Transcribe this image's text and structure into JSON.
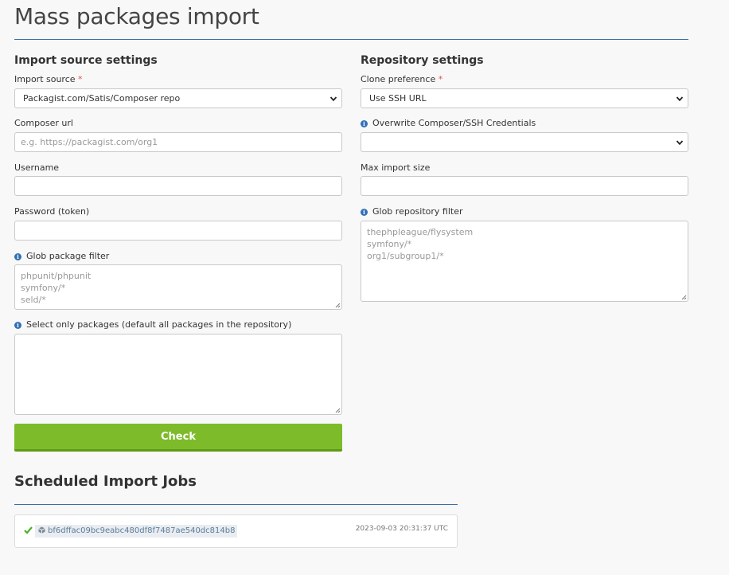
{
  "page": {
    "title": "Mass packages import"
  },
  "import_source": {
    "section_title": "Import source settings",
    "source_label": "Import source",
    "required_mark": "*",
    "source_value": "Packagist.com/Satis/Composer repo",
    "composer_url_label": "Composer url",
    "composer_url_placeholder": "e.g. https://packagist.com/org1",
    "username_label": "Username",
    "password_label": "Password (token)",
    "glob_package_filter_label": "Glob package filter",
    "glob_package_filter_placeholder": [
      "phpunit/phpunit",
      "symfony/*",
      "seld/*"
    ],
    "select_packages_label": "Select only packages (default all packages in the repository)",
    "check_button": "Check"
  },
  "repository": {
    "section_title": "Repository settings",
    "clone_label": "Clone preference",
    "required_mark": "*",
    "clone_value": "Use SSH URL",
    "overwrite_label": "Overwrite Composer/SSH Credentials",
    "overwrite_value": "",
    "max_import_label": "Max import size",
    "glob_repo_filter_label": "Glob repository filter",
    "glob_repo_filter_placeholder": [
      "thephpleague/flysystem",
      "symfony/*",
      "org1/subgroup1/*"
    ]
  },
  "jobs": {
    "title": "Scheduled Import Jobs",
    "items": [
      {
        "id": "bf6dffac09bc9eabc480df8f7487ae540dc814b8",
        "time": "2023-09-03 20:31:37 UTC",
        "status": "success"
      }
    ]
  },
  "colors": {
    "accent_rule": "#3a6ea5",
    "button": "#7dbb2a",
    "success": "#4caf2a",
    "info": "#2f6fb5",
    "required": "#d9534f"
  },
  "icons": [
    "chevron-down-icon",
    "info-icon",
    "resize-handle-icon",
    "checkmark-icon",
    "package-cube-icon"
  ]
}
